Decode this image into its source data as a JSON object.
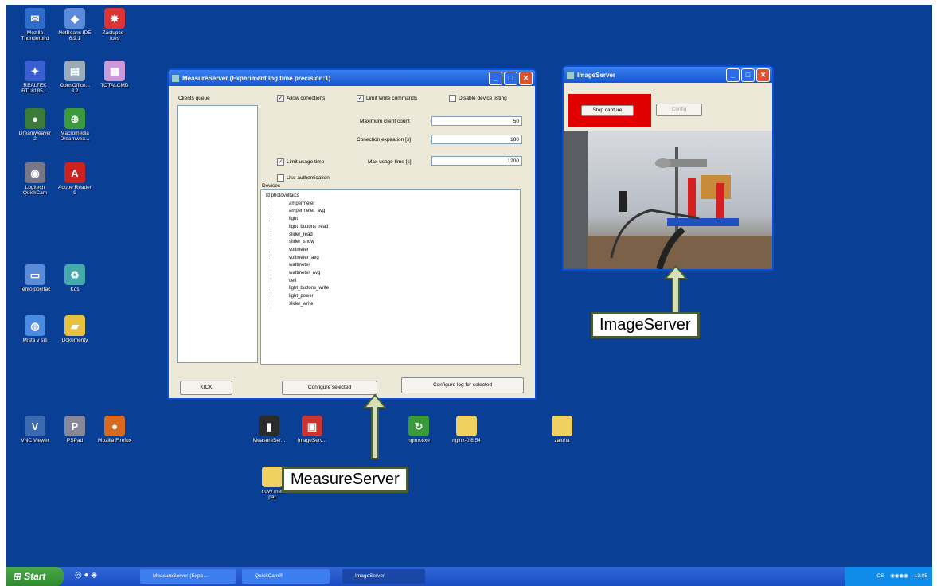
{
  "desktop_icons": [
    {
      "label": "Mozilla\nThunderbird",
      "icon": "thunderbird-icon",
      "color": "#2f6cc9"
    },
    {
      "label": "NetBeans IDE\n6.9.1",
      "icon": "netbeans-icon",
      "color": "#5a8ad8"
    },
    {
      "label": "Zástupce -\nIces",
      "icon": "shortcut-icon",
      "color": "#d33"
    },
    {
      "label": "REALTEK\nRTL8185 ...",
      "icon": "realtek-icon",
      "color": "#3a5fd0"
    },
    {
      "label": "OpenOffice...\n3.2",
      "icon": "openoffice-icon",
      "color": "#9ab"
    },
    {
      "label": "TOTALCMD",
      "icon": "totalcmd-icon",
      "color": "#c9d"
    },
    {
      "label": "Dreamweaver\n2",
      "icon": "dreamweaver-icon",
      "color": "#3a7a3a"
    },
    {
      "label": "Macromedia\nDreamwea...",
      "icon": "macromedia-icon",
      "color": "#3b9a3b"
    },
    {
      "label": "Logitech\nQuickCam",
      "icon": "quickcam-icon",
      "color": "#778"
    },
    {
      "label": "Adobe Reader\n9",
      "icon": "adobe-reader-icon",
      "color": "#c22"
    },
    {
      "label": "Tento počítač",
      "icon": "my-computer-icon",
      "color": "#5a8ad8"
    },
    {
      "label": "Koš",
      "icon": "recycle-bin-icon",
      "color": "#4aa"
    },
    {
      "label": "Místa v síti",
      "icon": "network-icon",
      "color": "#4a8ae0"
    },
    {
      "label": "Dokumenty",
      "icon": "documents-icon",
      "color": "#e8c040"
    },
    {
      "label": "VNC Viewer",
      "icon": "vnc-icon",
      "color": "#3a6ab0"
    },
    {
      "label": "PSPad",
      "icon": "pspad-icon",
      "color": "#889"
    },
    {
      "label": "Mozilla Firefox",
      "icon": "firefox-icon",
      "color": "#d86a20"
    },
    {
      "label": "MeasureSer...",
      "icon": "measureserver-shortcut-icon",
      "color": "#2b2b2b"
    },
    {
      "label": "ImageServ...",
      "icon": "imageserver-shortcut-icon",
      "color": "#c33"
    },
    {
      "label": "nginx.exe",
      "icon": "nginx-icon",
      "color": "#3a9a3a"
    },
    {
      "label": "nginx-0.8.54",
      "icon": "folder-icon",
      "color": "#f0d060"
    },
    {
      "label": "zaloha",
      "icon": "folder-icon",
      "color": "#f0d060"
    },
    {
      "label": "novy mer\npar",
      "icon": "folder-icon",
      "color": "#f0d060"
    }
  ],
  "measure_window": {
    "title": "MeasureServer (Experiment log time precision:1)",
    "clients_label": "Clients queue",
    "allow_connections": "Allow conections",
    "limit_write": "Limit Write commands",
    "disable_listing": "Disable device listing",
    "max_clients_label": "Maximum client count",
    "max_clients_value": "50",
    "expiration_label": "Conection expiration [s]",
    "expiration_value": "180",
    "limit_usage": "Limit usage time",
    "max_usage_label": "Max usage time [s]",
    "max_usage_value": "1200",
    "use_auth": "Use authentication",
    "devices_label": "Devices",
    "tree_root": "photovoltaics",
    "devices": [
      "ampermeter",
      "ampermeter_avg",
      "light",
      "light_buttons_read",
      "slider_read",
      "slider_show",
      "voltmeter",
      "voltmeter_avg",
      "wattmeter",
      "wattmeter_avg",
      "cell",
      "light_buttons_write",
      "light_power",
      "slider_write"
    ],
    "kick": "KICK",
    "configure_selected": "Configure selected",
    "configure_log": "Configure log for selected"
  },
  "image_window": {
    "title": "ImageServer",
    "stop_capture": "Stop capture",
    "config": "Config"
  },
  "callouts": {
    "image": "ImageServer",
    "measure": "MeasureServer"
  },
  "taskbar": {
    "start": "Start",
    "tasks": [
      "MeasureServer (Expe...",
      "QuickCam®",
      "ImageServer"
    ],
    "clock": "13:05",
    "lang": "CS"
  }
}
